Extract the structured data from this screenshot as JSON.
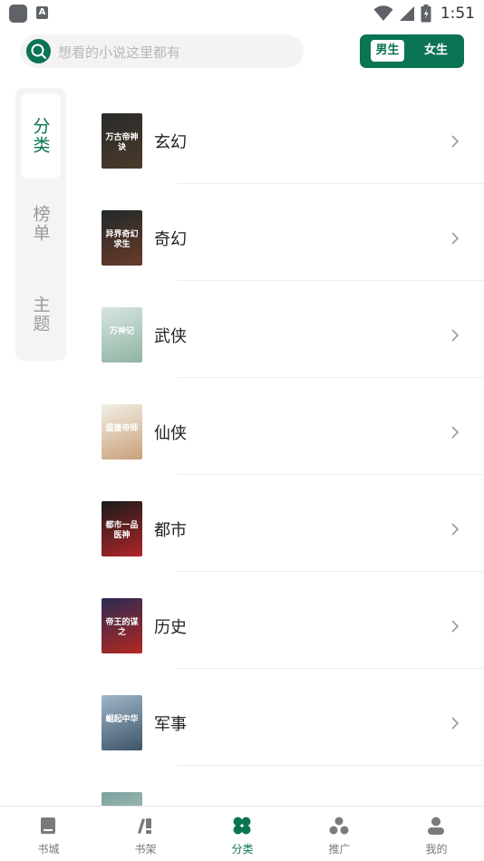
{
  "status_bar": {
    "time": "1:51",
    "notif_letter": "A"
  },
  "search": {
    "placeholder": "想看的小说这里都有"
  },
  "gender": {
    "male": "男生",
    "female": "女生",
    "selected": "男生"
  },
  "side_tabs": [
    {
      "label": "分类",
      "active": true
    },
    {
      "label": "榜单",
      "active": false
    },
    {
      "label": "主题",
      "active": false
    }
  ],
  "categories": [
    {
      "name": "玄幻",
      "cover_title": "万古帝神诀",
      "cover_colors": [
        "#2a2a2a",
        "#4a3b2a"
      ]
    },
    {
      "name": "奇幻",
      "cover_title": "异界奇幻求生",
      "cover_colors": [
        "#1f2a2a",
        "#6b3a2a"
      ]
    },
    {
      "name": "武侠",
      "cover_title": "万神记",
      "cover_colors": [
        "#d7e6df",
        "#8fb3a3"
      ]
    },
    {
      "name": "仙侠",
      "cover_title": "盛唐帝师",
      "cover_colors": [
        "#f2efe6",
        "#c9a07a"
      ]
    },
    {
      "name": "都市",
      "cover_title": "都市一品医神",
      "cover_colors": [
        "#1a1a1a",
        "#b0262a"
      ]
    },
    {
      "name": "历史",
      "cover_title": "帝王的谋之",
      "cover_colors": [
        "#2b2a55",
        "#b3281f"
      ]
    },
    {
      "name": "军事",
      "cover_title": "崛起中华",
      "cover_colors": [
        "#9fb6c8",
        "#3e5468"
      ]
    },
    {
      "name": "",
      "cover_title": "",
      "cover_colors": [
        "#7aa0a0",
        "#c6d3c2"
      ]
    }
  ],
  "bottom_nav": [
    {
      "label": "书城",
      "icon": "book-icon",
      "active": false
    },
    {
      "label": "书架",
      "icon": "bookshelf-icon",
      "active": false
    },
    {
      "label": "分类",
      "icon": "category-icon",
      "active": true
    },
    {
      "label": "推广",
      "icon": "share-icon",
      "active": false
    },
    {
      "label": "我的",
      "icon": "user-icon",
      "active": false
    }
  ],
  "colors": {
    "accent": "#0a7455",
    "inactive_text": "#999999",
    "divider": "#ececec"
  }
}
